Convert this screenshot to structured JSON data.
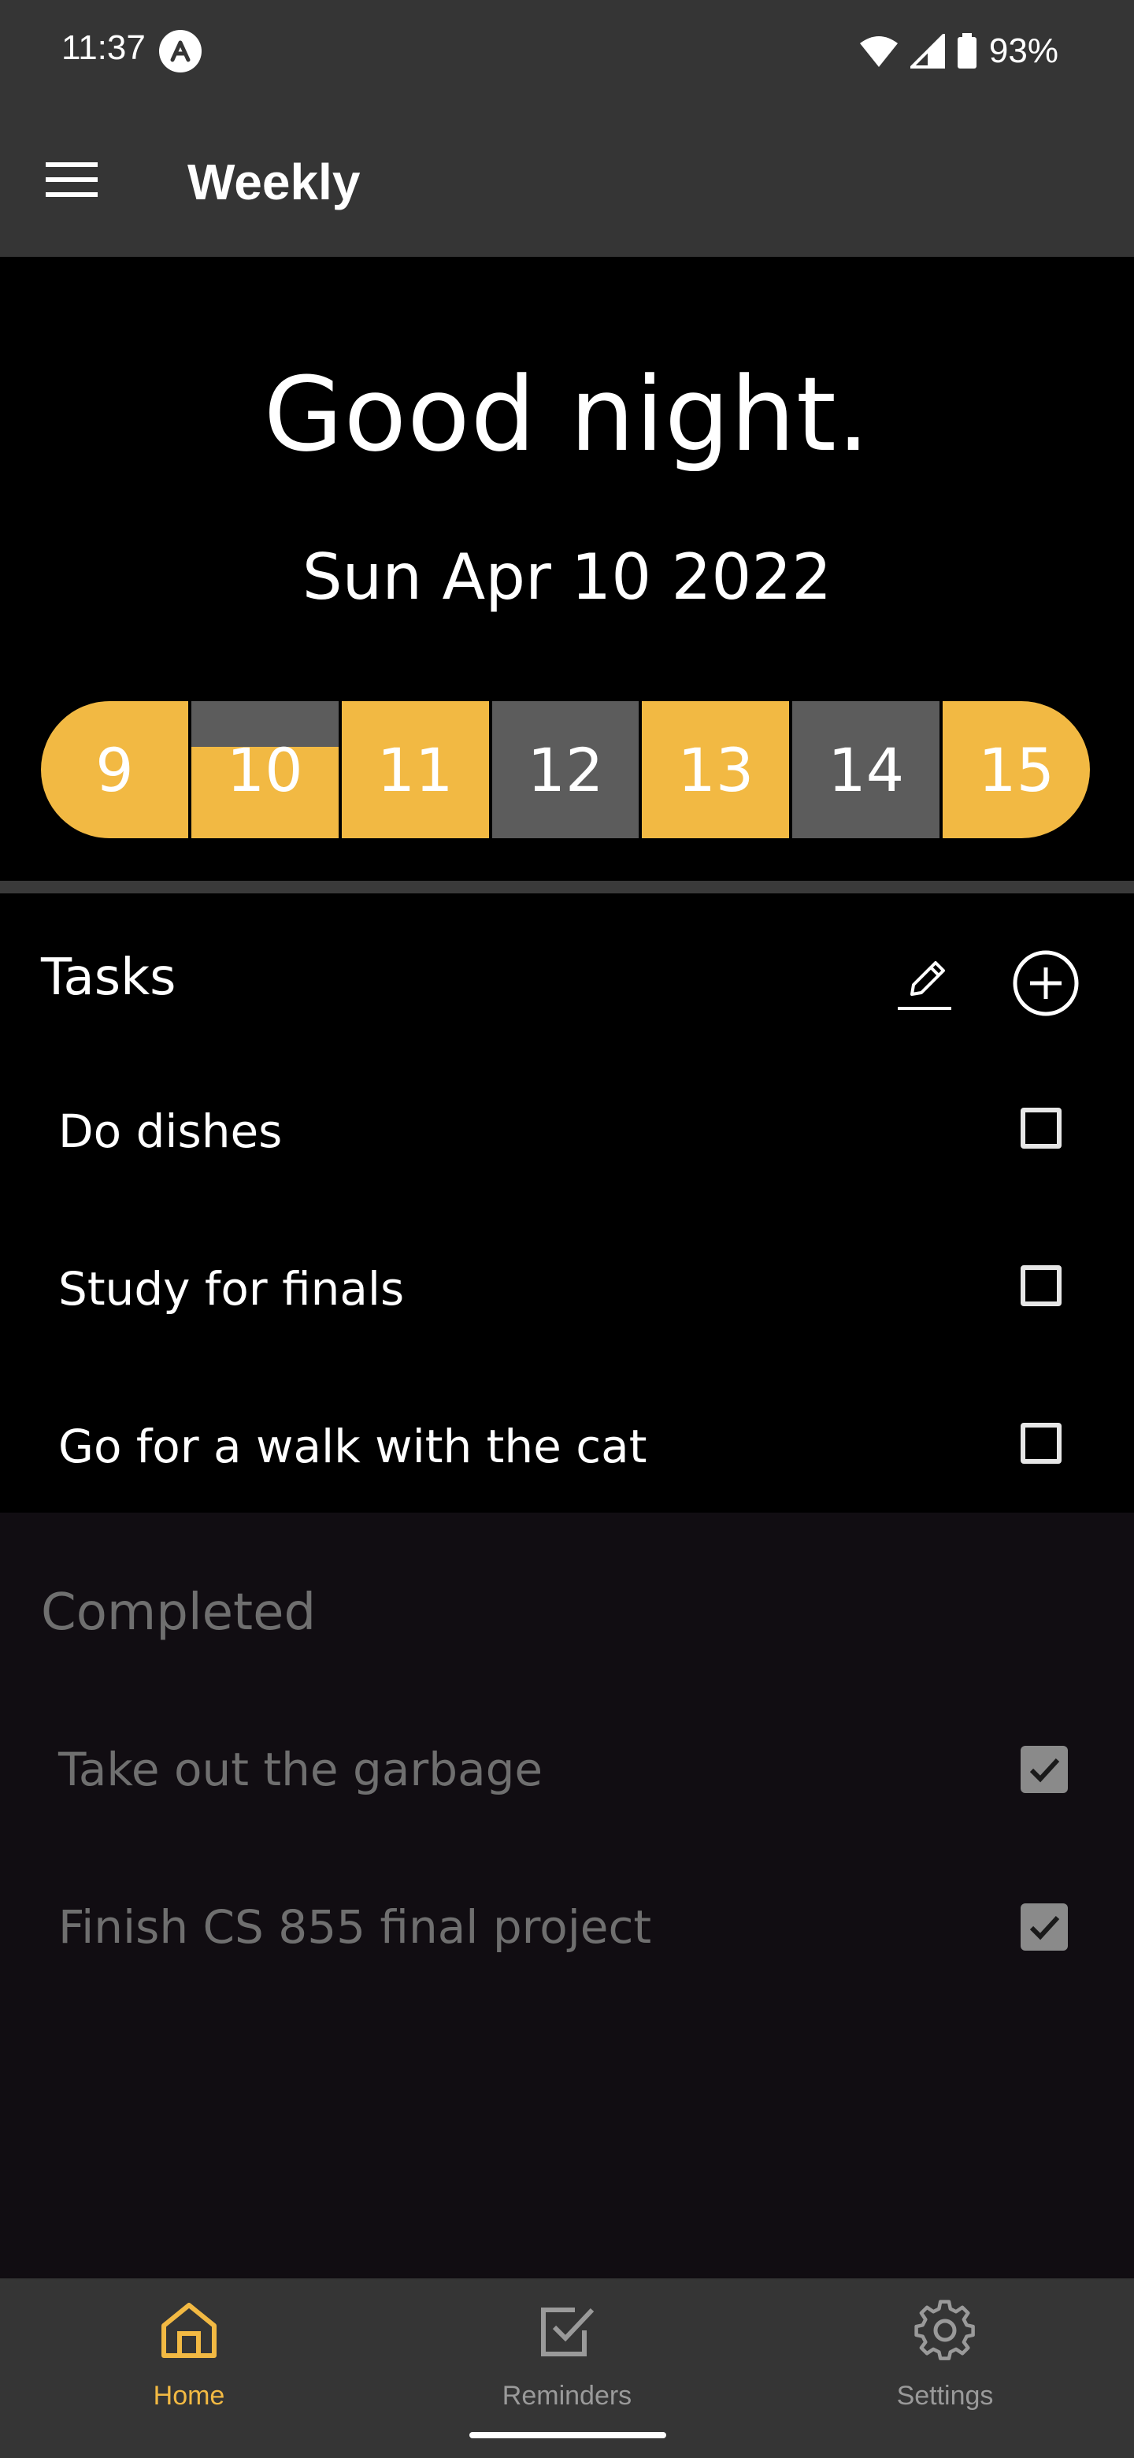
{
  "colors": {
    "accent": "#f2b943",
    "inactive_day": "#5c5c5c",
    "bar_bg": "#353535",
    "completed_text": "#6f6f6f"
  },
  "status_bar": {
    "time": "11:37",
    "battery": "93%",
    "icons": [
      "app-a-icon",
      "wifi-icon",
      "signal-icon",
      "battery-icon"
    ]
  },
  "app_bar": {
    "title": "Weekly",
    "menu_icon": "hamburger-menu-icon"
  },
  "greeting": "Good night.",
  "date": "Sun Apr 10 2022",
  "days": [
    {
      "label": "9",
      "state": "active"
    },
    {
      "label": "10",
      "state": "active-partial"
    },
    {
      "label": "11",
      "state": "active"
    },
    {
      "label": "12",
      "state": "inactive"
    },
    {
      "label": "13",
      "state": "active"
    },
    {
      "label": "14",
      "state": "inactive"
    },
    {
      "label": "15",
      "state": "active"
    }
  ],
  "tasks": {
    "title": "Tasks",
    "edit_icon": "pencil-icon",
    "add_icon": "plus-circle-icon",
    "items": [
      {
        "label": "Do dishes",
        "checked": false
      },
      {
        "label": "Study for finals",
        "checked": false
      },
      {
        "label": "Go for a walk with the cat",
        "checked": false
      }
    ]
  },
  "completed": {
    "title": "Completed",
    "items": [
      {
        "label": "Take out the garbage",
        "checked": true
      },
      {
        "label": "Finish CS 855 final project",
        "checked": true
      }
    ]
  },
  "bottom_nav": {
    "items": [
      {
        "label": "Home",
        "icon": "home-icon",
        "active": true
      },
      {
        "label": "Reminders",
        "icon": "checkbox-icon",
        "active": false
      },
      {
        "label": "Settings",
        "icon": "gear-icon",
        "active": false
      }
    ]
  }
}
